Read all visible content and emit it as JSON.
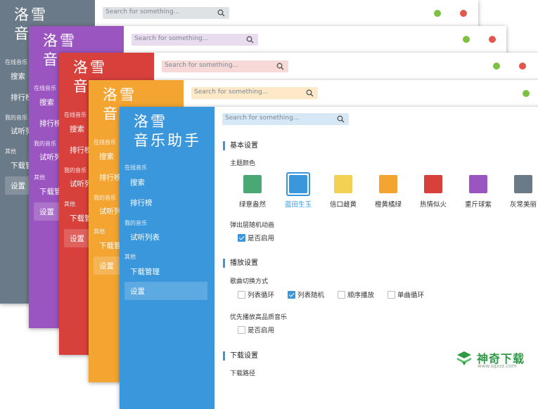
{
  "logo": {
    "line1": "洛雪",
    "line2": "音乐助手"
  },
  "search": {
    "placeholder": "Search for something..."
  },
  "nav": {
    "group_online": "在线音乐",
    "search": "搜索",
    "charts": "排行榜",
    "group_mine": "我的音乐",
    "playlist": "试听列表",
    "group_other": "其他",
    "downloads": "下载管理",
    "settings": "设置"
  },
  "back_windows": [
    {
      "theme": "灰常美丽",
      "color": "#6b7a88",
      "logo_line1": "洛雪",
      "logo_line2": "音",
      "nav_search": "搜索",
      "nav_charts": "排行榜",
      "nav_playlist": "试听列",
      "nav_downloads": "下载管",
      "nav_settings": "设置"
    },
    {
      "theme": "重斤球紫",
      "color": "#9a55c0",
      "logo_line1": "洛雪",
      "logo_line2": "音",
      "nav_search": "搜索",
      "nav_charts": "排行榜",
      "nav_playlist": "试听列",
      "nav_downloads": "下载管",
      "nav_settings": "设置"
    },
    {
      "theme": "热情似火",
      "color": "#d8403c",
      "logo_line1": "洛雪",
      "logo_line2": "音",
      "nav_search": "搜索",
      "nav_charts": "排行榜",
      "nav_playlist": "试听列",
      "nav_downloads": "下载管",
      "nav_settings": "设置"
    },
    {
      "theme": "橙黄橘绿",
      "color": "#f3a431",
      "logo_line1": "洛雪",
      "logo_line2": "音",
      "nav_search": "搜索",
      "nav_charts": "排行榜",
      "nav_playlist": "试听列",
      "nav_downloads": "下载管",
      "nav_settings": "设置"
    }
  ],
  "settings": {
    "basic": {
      "title": "基本设置",
      "theme_color_label": "主题颜色",
      "themes": [
        {
          "name": "绿意盎然",
          "color": "#4aa875",
          "selected": false
        },
        {
          "name": "蓝田生玉",
          "color": "#3a97dc",
          "selected": true
        },
        {
          "name": "信口雌黄",
          "color": "#f2d155",
          "selected": false
        },
        {
          "name": "橙黄橘绿",
          "color": "#f3a431",
          "selected": false
        },
        {
          "name": "热情似火",
          "color": "#d8403c",
          "selected": false
        },
        {
          "name": "重斤球紫",
          "color": "#9a55c0",
          "selected": false
        },
        {
          "name": "灰常美丽",
          "color": "#6b7a88",
          "selected": false
        }
      ],
      "popup_anim_label": "弹出层随机动画",
      "popup_anim_enable": "是否启用",
      "popup_anim_checked": true
    },
    "play": {
      "title": "播放设置",
      "switch_mode_label": "歌曲切换方式",
      "modes": [
        {
          "name": "列表循环",
          "checked": false
        },
        {
          "name": "列表随机",
          "checked": true
        },
        {
          "name": "顺序播放",
          "checked": false
        },
        {
          "name": "单曲循环",
          "checked": false
        }
      ],
      "hq_label": "优先播放高品质音乐",
      "hq_enable": "是否启用",
      "hq_checked": false
    },
    "download": {
      "title": "下载设置",
      "path_label": "下载路径"
    }
  },
  "watermark": {
    "title": "神奇下载",
    "url": "www.sqxzz.com"
  },
  "colors": {
    "accent": "#3a97dc",
    "dot_green": "#7cc142",
    "dot_red": "#e2574c"
  }
}
